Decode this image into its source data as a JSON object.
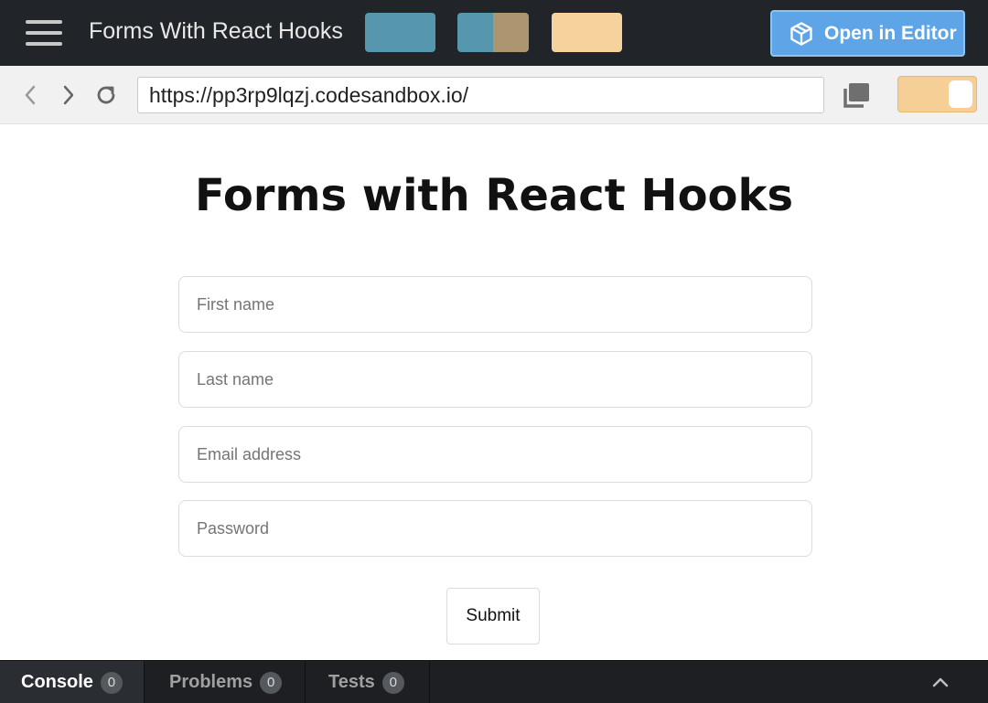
{
  "topbar": {
    "title": "Forms With React Hooks",
    "open_editor_label": "Open in Editor",
    "layout_colors": {
      "preview_only": "#5797ad",
      "split_left": "#5797ad",
      "split_right": "#ae9572",
      "editor_only": "#f6d39c"
    }
  },
  "navbar": {
    "url": "https://pp3rp9lqzj.codesandbox.io/"
  },
  "preview": {
    "heading": "Forms with React Hooks",
    "fields": {
      "first_name": "First name",
      "last_name": "Last name",
      "email": "Email address",
      "password": "Password"
    },
    "submit_label": "Submit"
  },
  "bottombar": {
    "tabs": [
      {
        "label": "Console",
        "count": "0"
      },
      {
        "label": "Problems",
        "count": "0"
      },
      {
        "label": "Tests",
        "count": "0"
      }
    ]
  },
  "colors": {
    "accent": "#5ea5e8",
    "toggle": "#f6cf96"
  }
}
